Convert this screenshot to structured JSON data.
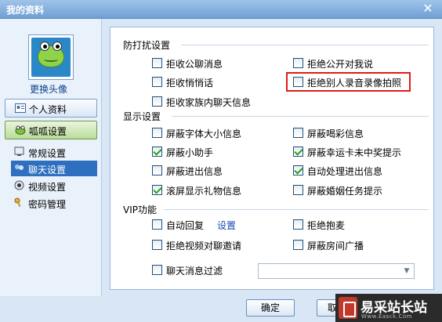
{
  "window": {
    "title": "我的资料",
    "close_label": "✕"
  },
  "left_nav": {
    "change_avatar": "更换头像",
    "buttons": [
      {
        "label": "个人资料",
        "icon": "profile-card-icon"
      },
      {
        "label": "呱呱设置",
        "icon": "frog-settings-icon"
      }
    ],
    "sub_items": [
      {
        "label": "常规设置",
        "icon": "general-settings-icon"
      },
      {
        "label": "聊天设置",
        "icon": "chat-settings-icon",
        "selected": true
      },
      {
        "label": "视频设置",
        "icon": "video-settings-icon"
      },
      {
        "label": "密码管理",
        "icon": "key-icon"
      }
    ]
  },
  "sections": {
    "anti_disturb": {
      "title": "防打扰设置",
      "options": [
        {
          "label": "拒收公聊消息",
          "checked": false
        },
        {
          "label": "拒绝公开对我说",
          "checked": false
        },
        {
          "label": "拒收悄悄话",
          "checked": false
        },
        {
          "label": "拒绝别人录音录像拍照",
          "checked": false,
          "highlighted": true
        },
        {
          "label": "拒收家族内聊天信息",
          "checked": false
        }
      ]
    },
    "display": {
      "title": "显示设置",
      "options": [
        {
          "label": "屏蔽字体大小信息",
          "checked": false
        },
        {
          "label": "屏蔽喝彩信息",
          "checked": false
        },
        {
          "label": "屏蔽小助手",
          "checked": true
        },
        {
          "label": "屏蔽幸运卡未中奖提示",
          "checked": true
        },
        {
          "label": "屏蔽进出信息",
          "checked": false
        },
        {
          "label": "自动处理进出信息",
          "checked": true
        },
        {
          "label": "滚屏显示礼物信息",
          "checked": true
        },
        {
          "label": "屏蔽婚姻任务提示",
          "checked": false
        }
      ]
    },
    "vip": {
      "title": "VIP功能",
      "auto_reply": {
        "label": "自动回复",
        "checked": false
      },
      "auto_reply_link": "设置",
      "reject_hug": {
        "label": "拒绝抱麦",
        "checked": false
      },
      "reject_video": {
        "label": "拒绝视频对聊邀请",
        "checked": false
      },
      "block_room_broadcast": {
        "label": "屏蔽房间广播",
        "checked": false
      },
      "chat_filter": {
        "label": "聊天消息过滤",
        "checked": false
      },
      "filter_value": ""
    }
  },
  "footer": {
    "ok_label": "确定",
    "cancel_label": "取"
  },
  "watermark": {
    "text": "易采站长站",
    "sub": "Www.Easck.Com"
  },
  "colors": {
    "highlight": "#e11b1b",
    "selected_nav": "#2f6fbf",
    "check": "#21a121"
  }
}
